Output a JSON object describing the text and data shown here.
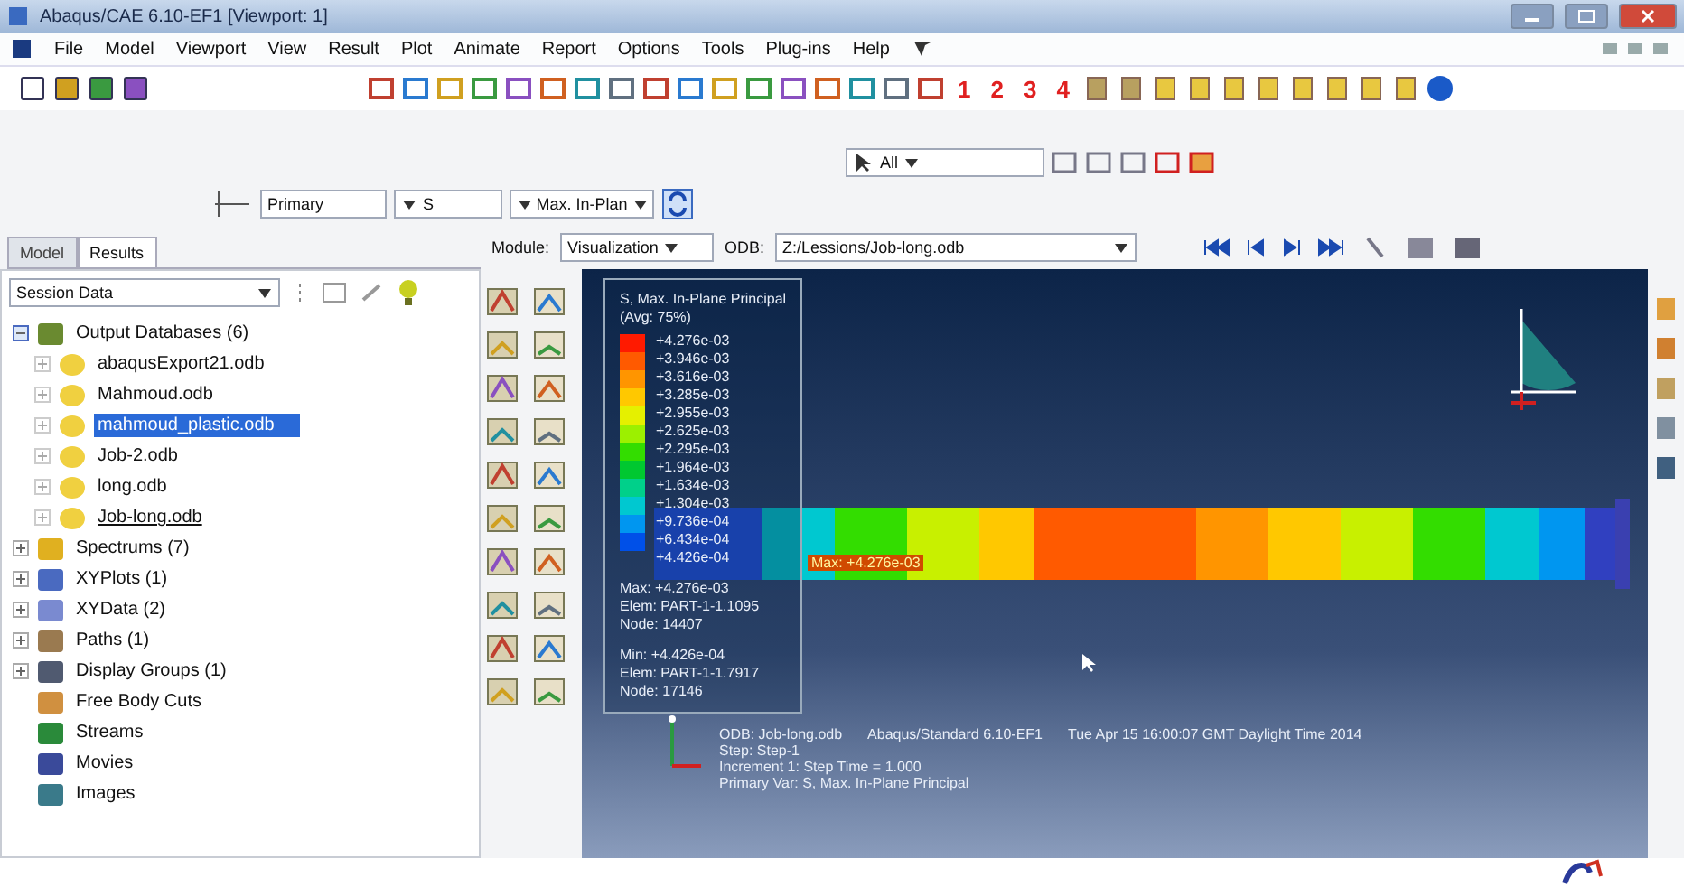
{
  "window": {
    "title": "Abaqus/CAE 6.10-EF1 [Viewport: 1]"
  },
  "menu": [
    "File",
    "Model",
    "Viewport",
    "View",
    "Result",
    "Plot",
    "Animate",
    "Report",
    "Options",
    "Tools",
    "Plug-ins",
    "Help"
  ],
  "view_numbers": [
    "1",
    "2",
    "3",
    "4"
  ],
  "selection": {
    "filter": "All"
  },
  "field_output": {
    "step": "Primary",
    "variable": "S",
    "component": "Max. In-Plan"
  },
  "tabs": [
    {
      "label": "Model",
      "selected": false
    },
    {
      "label": "Results",
      "selected": true
    }
  ],
  "module": {
    "label": "Module:",
    "value": "Visualization"
  },
  "odb": {
    "label": "ODB:",
    "value": "Z:/Lessions/Job-long.odb"
  },
  "tree": {
    "dropdown": "Session Data",
    "items": [
      {
        "label": "Output Databases (6)",
        "expanded": true,
        "children": [
          {
            "label": "abaqusExport21.odb",
            "selected": false,
            "current": false
          },
          {
            "label": "Mahmoud.odb",
            "selected": false,
            "current": false
          },
          {
            "label": "mahmoud_plastic.odb",
            "selected": true,
            "current": false
          },
          {
            "label": "Job-2.odb",
            "selected": false,
            "current": false
          },
          {
            "label": "long.odb",
            "selected": false,
            "current": false
          },
          {
            "label": "Job-long.odb",
            "selected": false,
            "current": true
          }
        ]
      },
      {
        "label": "Spectrums (7)",
        "expanded": false
      },
      {
        "label": "XYPlots (1)",
        "expanded": false
      },
      {
        "label": "XYData (2)",
        "expanded": false
      },
      {
        "label": "Paths (1)",
        "expanded": false
      },
      {
        "label": "Display Groups (1)",
        "expanded": false
      },
      {
        "label": "Free Body Cuts"
      },
      {
        "label": "Streams"
      },
      {
        "label": "Movies"
      },
      {
        "label": "Images"
      }
    ]
  },
  "legend": {
    "title": "S, Max. In-Plane Principal",
    "subtitle": "(Avg: 75%)",
    "values": [
      "+4.276e-03",
      "+3.946e-03",
      "+3.616e-03",
      "+3.285e-03",
      "+2.955e-03",
      "+2.625e-03",
      "+2.295e-03",
      "+1.964e-03",
      "+1.634e-03",
      "+1.304e-03",
      "+9.736e-04",
      "+6.434e-04",
      "+4.426e-04"
    ],
    "max": [
      "Max: +4.276e-03",
      "Elem: PART-1-1.1095",
      "Node: 14407"
    ],
    "min": [
      "Min: +4.426e-04",
      "Elem: PART-1-1.7917",
      "Node: 17146"
    ]
  },
  "beam_label": "Max: +4.276e-03",
  "info": {
    "header": [
      "ODB: Job-long.odb",
      "Abaqus/Standard 6.10-EF1",
      "Tue Apr 15 16:00:07 GMT Daylight Time 2014"
    ],
    "lines": [
      "Step: Step-1",
      "Increment     1: Step Time =    1.000",
      "Primary Var: S, Max. In-Plane Principal"
    ]
  }
}
